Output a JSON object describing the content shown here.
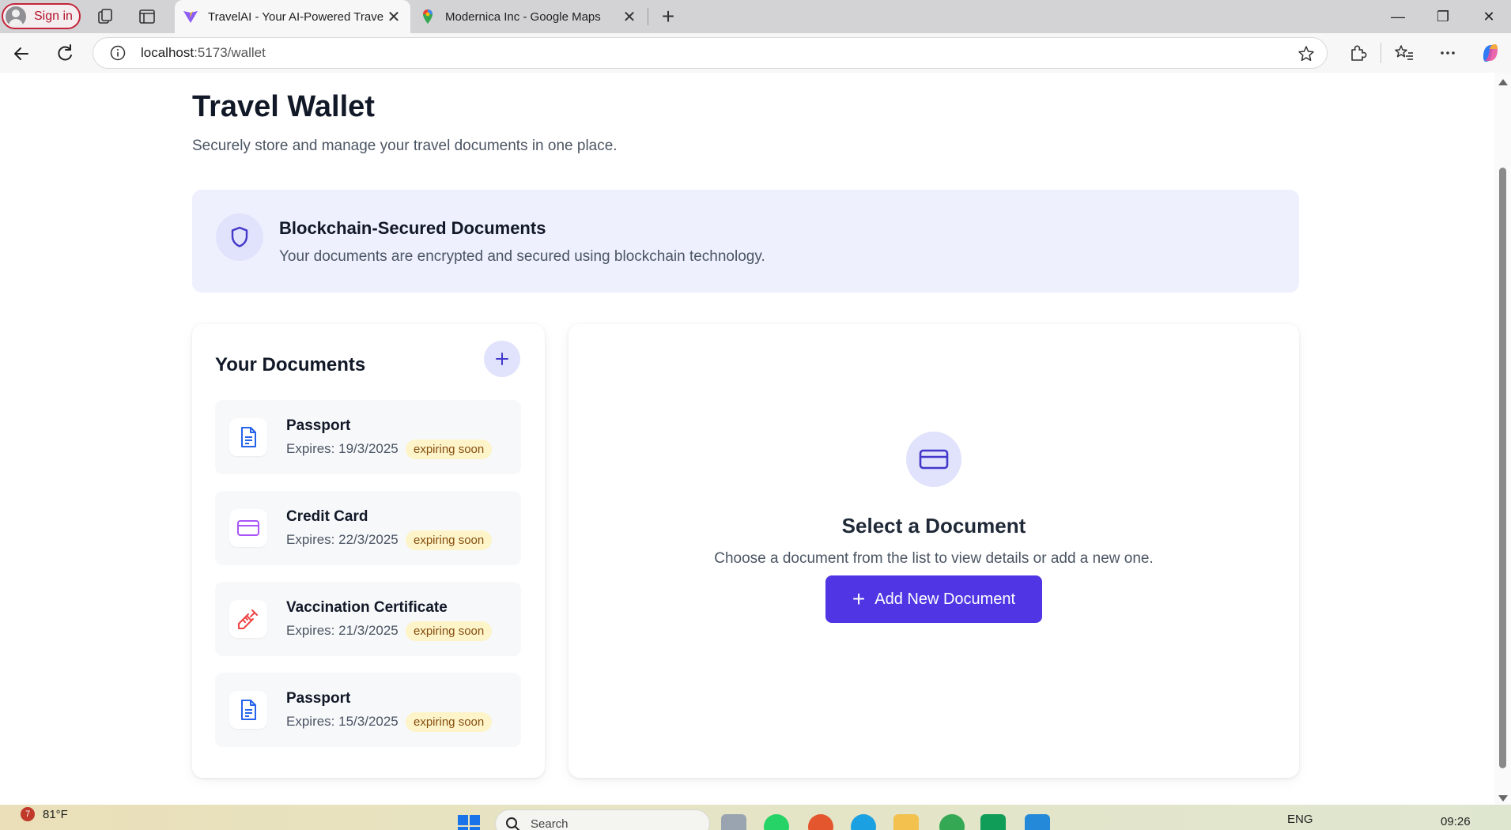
{
  "browser": {
    "signin_label": "Sign in",
    "tabs": [
      {
        "title": "TravelAI - Your AI-Powered Travel Companion",
        "active": true
      },
      {
        "title": "Modernica Inc - Google Maps",
        "active": false
      }
    ],
    "url_host": "localhost",
    "url_path": ":5173/wallet"
  },
  "page": {
    "title": "Travel Wallet",
    "subtitle": "Securely store and manage your travel documents in one place."
  },
  "banner": {
    "title": "Blockchain-Secured Documents",
    "text": "Your documents are encrypted and secured using blockchain technology."
  },
  "documents": {
    "heading": "Your Documents",
    "items": [
      {
        "name": "Passport",
        "expires": "Expires: 19/3/2025",
        "badge": "expiring soon",
        "icon": "file-text-icon",
        "color": "#2563eb"
      },
      {
        "name": "Credit Card",
        "expires": "Expires: 22/3/2025",
        "badge": "expiring soon",
        "icon": "credit-card-icon",
        "color": "#a855f7"
      },
      {
        "name": "Vaccination Certificate",
        "expires": "Expires: 21/3/2025",
        "badge": "expiring soon",
        "icon": "syringe-icon",
        "color": "#ef4444"
      },
      {
        "name": "Passport",
        "expires": "Expires: 15/3/2025",
        "badge": "expiring soon",
        "icon": "file-text-icon",
        "color": "#2563eb"
      }
    ]
  },
  "detail": {
    "title": "Select a Document",
    "description": "Choose a document from the list to view details or add a new one.",
    "button_label": "Add New Document"
  },
  "taskbar": {
    "weather_badge": "7",
    "temperature": "81°F",
    "search_placeholder": "Search",
    "language": "ENG",
    "time": "09:26"
  },
  "colors": {
    "accent": "#4f35e3",
    "banner_bg": "#eef0fe",
    "badge_bg": "#fdf4c9",
    "badge_text": "#854d0e"
  }
}
